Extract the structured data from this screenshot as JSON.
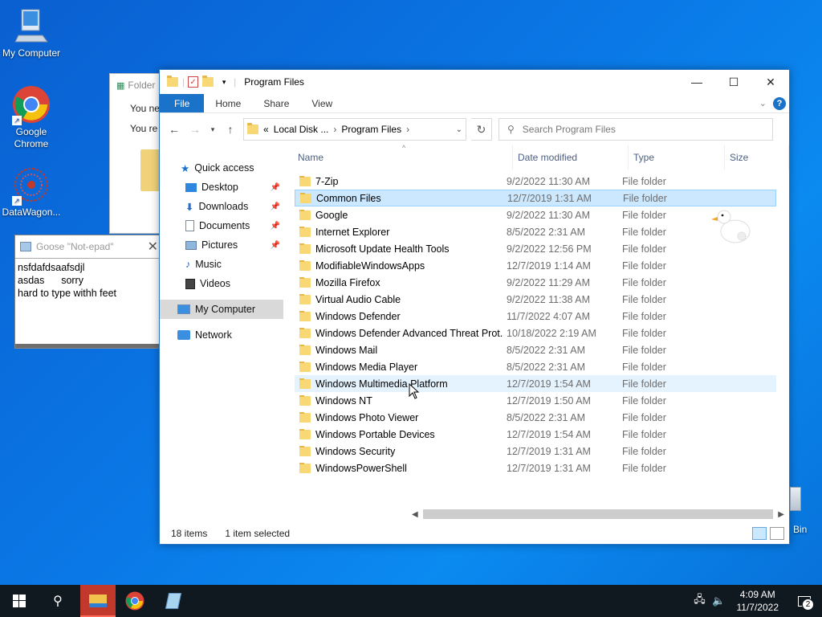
{
  "desktop": {
    "icons": [
      {
        "label": "My Computer"
      },
      {
        "label": "Google Chrome"
      },
      {
        "label": "DataWagon..."
      }
    ],
    "recycle_bin_label": "Bin"
  },
  "background_window": {
    "title": "Folder",
    "line1": "You ne",
    "line2": "You re"
  },
  "notepad": {
    "title": "Goose \"Not-epad\"",
    "lines": [
      "nsfdafdsaafsdjl",
      "asdas      sorry",
      "hard to type withh feet"
    ]
  },
  "explorer": {
    "title": "Program Files",
    "tabs": {
      "file": "File",
      "home": "Home",
      "share": "Share",
      "view": "View"
    },
    "address": {
      "prefix": "«",
      "crumb1": "Local Disk ...",
      "crumb2": "Program Files"
    },
    "search_placeholder": "Search Program Files",
    "nav": {
      "quick_access": "Quick access",
      "desktop": "Desktop",
      "downloads": "Downloads",
      "documents": "Documents",
      "pictures": "Pictures",
      "music": "Music",
      "videos": "Videos",
      "my_computer": "My Computer",
      "network": "Network"
    },
    "columns": {
      "name": "Name",
      "date": "Date modified",
      "type": "Type",
      "size": "Size"
    },
    "rows": [
      {
        "name": "7-Zip",
        "date": "9/2/2022 11:30 AM",
        "type": "File folder"
      },
      {
        "name": "Common Files",
        "date": "12/7/2019 1:31 AM",
        "type": "File folder"
      },
      {
        "name": "Google",
        "date": "9/2/2022 11:30 AM",
        "type": "File folder"
      },
      {
        "name": "Internet Explorer",
        "date": "8/5/2022 2:31 AM",
        "type": "File folder"
      },
      {
        "name": "Microsoft Update Health Tools",
        "date": "9/2/2022 12:56 PM",
        "type": "File folder"
      },
      {
        "name": "ModifiableWindowsApps",
        "date": "12/7/2019 1:14 AM",
        "type": "File folder"
      },
      {
        "name": "Mozilla Firefox",
        "date": "9/2/2022 11:29 AM",
        "type": "File folder"
      },
      {
        "name": "Virtual Audio Cable",
        "date": "9/2/2022 11:38 AM",
        "type": "File folder"
      },
      {
        "name": "Windows Defender",
        "date": "11/7/2022 4:07 AM",
        "type": "File folder"
      },
      {
        "name": "Windows Defender Advanced Threat Prot...",
        "date": "10/18/2022 2:19 AM",
        "type": "File folder"
      },
      {
        "name": "Windows Mail",
        "date": "8/5/2022 2:31 AM",
        "type": "File folder"
      },
      {
        "name": "Windows Media Player",
        "date": "8/5/2022 2:31 AM",
        "type": "File folder"
      },
      {
        "name": "Windows Multimedia Platform",
        "date": "12/7/2019 1:54 AM",
        "type": "File folder"
      },
      {
        "name": "Windows NT",
        "date": "12/7/2019 1:50 AM",
        "type": "File folder"
      },
      {
        "name": "Windows Photo Viewer",
        "date": "8/5/2022 2:31 AM",
        "type": "File folder"
      },
      {
        "name": "Windows Portable Devices",
        "date": "12/7/2019 1:54 AM",
        "type": "File folder"
      },
      {
        "name": "Windows Security",
        "date": "12/7/2019 1:31 AM",
        "type": "File folder"
      },
      {
        "name": "WindowsPowerShell",
        "date": "12/7/2019 1:31 AM",
        "type": "File folder"
      }
    ],
    "selected_row": "Common Files",
    "hover_row": "Windows Multimedia Platform",
    "status": {
      "count": "18 items",
      "selection": "1 item selected"
    }
  },
  "taskbar": {
    "time": "4:09 AM",
    "date": "11/7/2022",
    "notification_count": "2"
  },
  "colors": {
    "accent": "#1a73c8",
    "selected_row": "#cce8ff",
    "taskbar": "#101820",
    "active_app": "#c0392b"
  }
}
